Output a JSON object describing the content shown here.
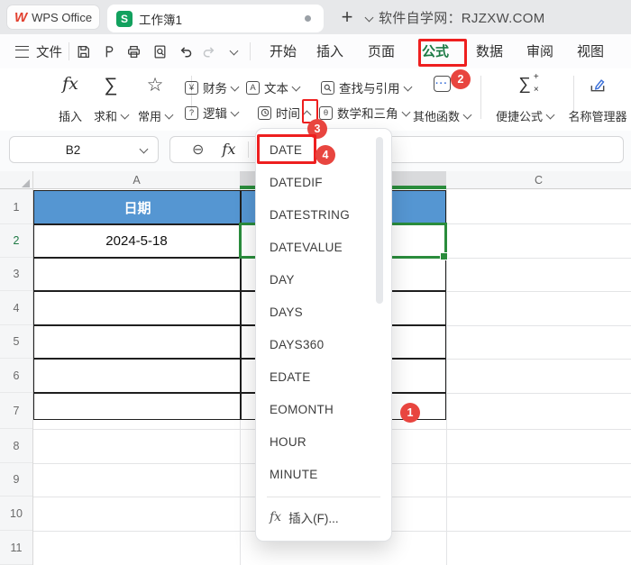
{
  "titlebar": {
    "app_name": "WPS Office",
    "doc_tab": "工作簿1",
    "new_tab_label": "+",
    "site_note": "软件自学网：RJZXW.COM"
  },
  "menubar": {
    "file_label": "文件",
    "tabs": [
      "开始",
      "插入",
      "页面",
      "公式",
      "数据",
      "审阅",
      "视图"
    ],
    "active_tab": "公式"
  },
  "ribbon": {
    "insert_fn_icon": "fx",
    "insert_fn_label": "插入",
    "sum_icon": "∑",
    "sum_label": "求和",
    "common_icon": "☆",
    "common_label": "常用",
    "cat_finance": "财务",
    "cat_text": "文本",
    "cat_lookup": "查找与引用",
    "cat_logic": "逻辑",
    "cat_time": "时间",
    "cat_math": "数学和三角",
    "more_fns_label": "其他函数",
    "quick_formula_icon": "∑",
    "quick_formula_label": "便捷公式",
    "name_manager_label": "名称管理器",
    "icon_finance_glyph": "¥",
    "icon_text_glyph": "A",
    "icon_logic_glyph": "?",
    "icon_math_glyph": "θ",
    "icon_more_glyph": "···"
  },
  "formula_bar": {
    "name_box_value": "B2",
    "fx_icon_text": "fx",
    "zoom_icon_glyph": "⊖"
  },
  "sheet": {
    "col_a": "A",
    "col_c": "C",
    "row_numbers": [
      "1",
      "2",
      "3",
      "4",
      "5",
      "6",
      "7",
      "8",
      "9",
      "10",
      "11"
    ],
    "a1": "日期",
    "a2": "2024-5-18",
    "selected_cell": "B2"
  },
  "dropdown": {
    "items": [
      "DATE",
      "DATEDIF",
      "DATESTRING",
      "DATEVALUE",
      "DAY",
      "DAYS",
      "DAYS360",
      "EDATE",
      "EOMONTH",
      "HOUR",
      "MINUTE"
    ],
    "highlighted_item": "DATE",
    "fx_icon_text": "fx",
    "insert_label": "插入(F)..."
  },
  "annotations": {
    "step1": "1",
    "step2": "2",
    "step3": "3",
    "step4": "4"
  },
  "colors": {
    "header_blue": "#5596d2",
    "selection_green": "#2a8c3c",
    "accent_green": "#1b7a44",
    "annotation_red": "#e8453f",
    "box_red": "#ee1f1f",
    "doc_icon_green": "#12a15e"
  }
}
